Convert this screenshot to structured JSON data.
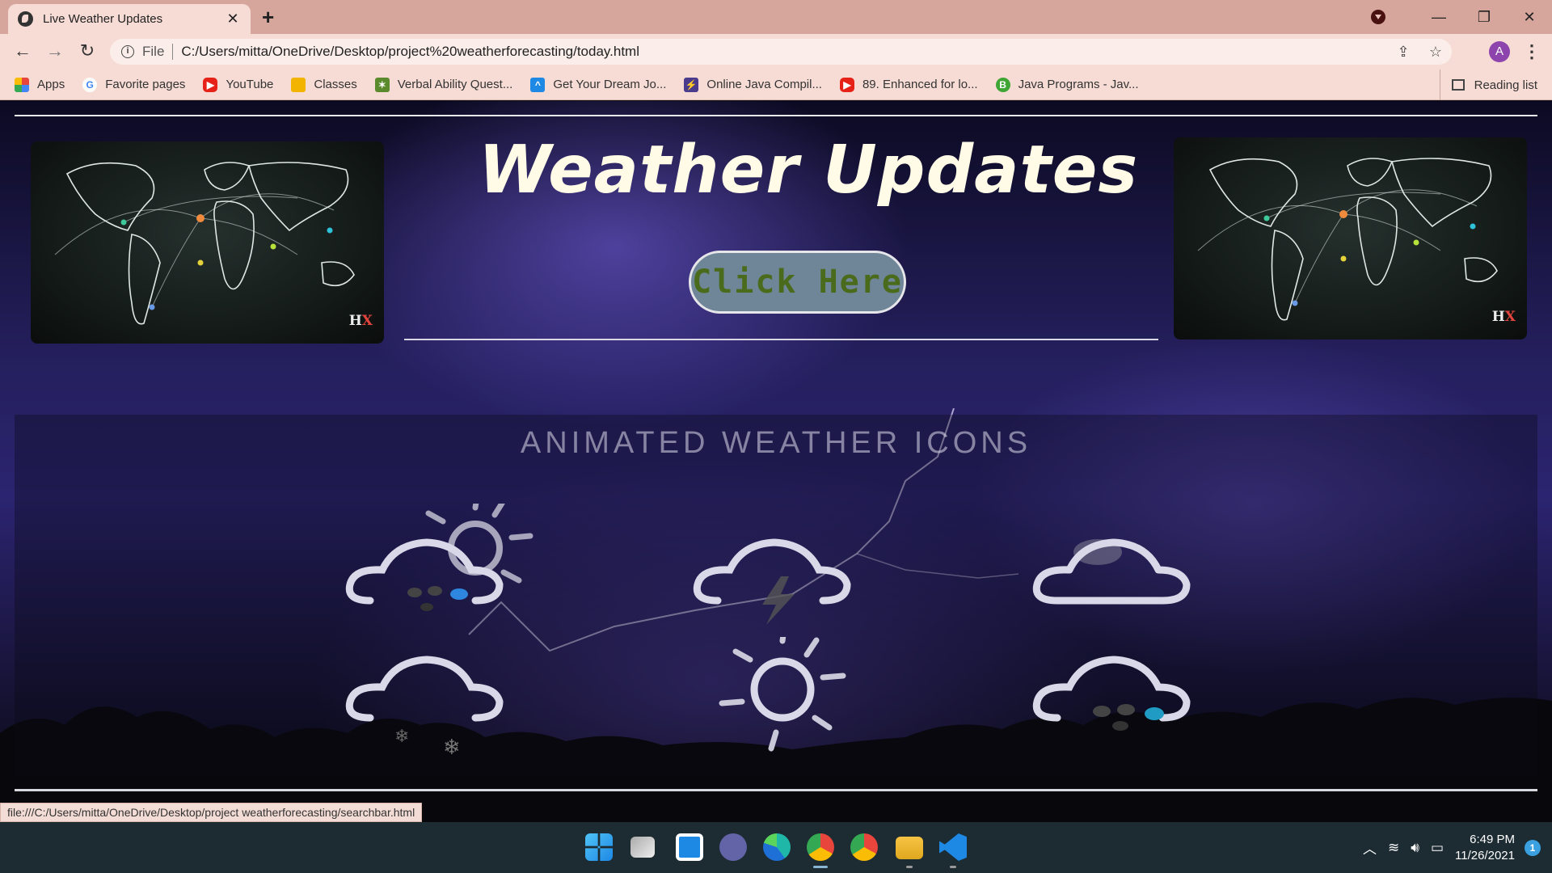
{
  "browser": {
    "tab_title": "Live Weather Updates",
    "tab_close": "✕",
    "new_tab": "+",
    "window_buttons": [
      "—",
      "❐",
      "✕"
    ],
    "nav": {
      "back": "←",
      "forward": "→",
      "reload": "↻"
    },
    "address": {
      "scheme_label": "File",
      "url": "C:/Users/mitta/OneDrive/Desktop/project%20weatherforecasting/today.html"
    },
    "profile_initial": "A",
    "menu": "⋮",
    "bookmarks": [
      {
        "label": "Apps",
        "icon": "apps-grid-icon",
        "color": "#e8453c"
      },
      {
        "label": "Favorite pages",
        "icon": "google-icon",
        "color": "#4285f4"
      },
      {
        "label": "YouTube",
        "icon": "youtube-icon",
        "color": "#e62117"
      },
      {
        "label": "Classes",
        "icon": "classroom-icon",
        "color": "#f2b400"
      },
      {
        "label": "Verbal Ability Quest...",
        "icon": "indiabix-icon",
        "color": "#5b8a2c"
      },
      {
        "label": "Get Your Dream Jo...",
        "icon": "jobs-icon",
        "color": "#1e88e5"
      },
      {
        "label": "Online Java Compil...",
        "icon": "compiler-icon",
        "color": "#4a3b8c"
      },
      {
        "label": "89. Enhanced for lo...",
        "icon": "youtube-icon",
        "color": "#e62117"
      },
      {
        "label": "Java Programs - Jav...",
        "icon": "beginnersbook-icon",
        "color": "#3fa535"
      }
    ],
    "reading_list": "Reading list",
    "status_url": "file:///C:/Users/mitta/OneDrive/Desktop/project weatherforecasting/searchbar.html"
  },
  "page": {
    "title": "Weather Updates",
    "cta_label": "Click Here",
    "logo_text_h": "H",
    "logo_text_x": "X",
    "icons_heading": "ANIMATED WEATHER ICONS",
    "weather_icons": [
      "sun-shower-icon",
      "thunderstorm-icon",
      "cloudy-icon",
      "flurries-icon",
      "sunny-icon",
      "rainy-icon"
    ]
  },
  "taskbar": {
    "apps": [
      "windows-start-icon",
      "task-view-icon",
      "widgets-icon",
      "teams-chat-icon",
      "edge-icon",
      "chrome-profile-icon",
      "chrome-icon",
      "file-explorer-icon",
      "vscode-icon"
    ],
    "time": "6:49 PM",
    "date": "11/26/2021",
    "notifications": "1"
  },
  "colors": {
    "tab_strip": "#d6a59c",
    "toolbar": "#f7dcd5",
    "title": "#fffbe6",
    "cta_bg": "#6e8697",
    "cta_text": "#4b6b1c",
    "taskbar": "#1d2b33"
  }
}
